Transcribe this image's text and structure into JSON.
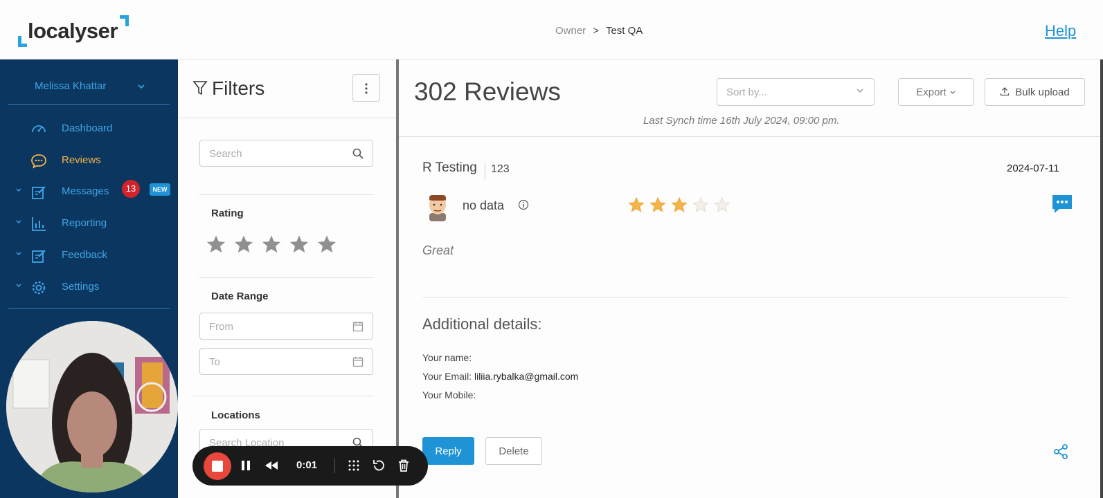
{
  "app": {
    "logo_text": "localyser",
    "breadcrumb": {
      "parent": "Owner",
      "separator": ">",
      "current": "Test QA"
    },
    "help_label": "Help"
  },
  "sidebar": {
    "user_name": "Melissa Khattar",
    "items": [
      {
        "label": "Dashboard",
        "icon": "dashboard-gauge-icon",
        "active": false
      },
      {
        "label": "Reviews",
        "icon": "chat-bubble-icon",
        "active": true
      },
      {
        "label": "Messages",
        "icon": "edit-note-icon",
        "badge_count": "13",
        "badge_new": "NEW"
      },
      {
        "label": "Reporting",
        "icon": "bar-chart-icon"
      },
      {
        "label": "Feedback",
        "icon": "feedback-edit-icon"
      },
      {
        "label": "Settings",
        "icon": "gear-icon"
      }
    ]
  },
  "filters": {
    "title": "Filters",
    "search_placeholder": "Search",
    "rating_label": "Rating",
    "date_range_label": "Date Range",
    "from_placeholder": "From",
    "to_placeholder": "To",
    "locations_label": "Locations",
    "location_placeholder": "Search Location"
  },
  "main": {
    "review_count": "302 Reviews",
    "sort_placeholder": "Sort by...",
    "export_label": "Export",
    "bulk_upload_label": "Bulk upload",
    "sync_text": "Last Synch time 16th July 2024, 09:00 pm."
  },
  "review": {
    "name": "R Testing",
    "id": "123",
    "date": "2024-07-11",
    "author": "no data",
    "rating": 3,
    "max_rating": 5,
    "comment": "Great",
    "additional_title": "Additional details:",
    "name_label": "Your name:",
    "name_value": "",
    "email_label": "Your Email:",
    "email_value": "liliia.rybalka@gmail.com",
    "mobile_label": "Your Mobile:",
    "mobile_value": "",
    "reply_label": "Reply",
    "delete_label": "Delete"
  },
  "recorder": {
    "elapsed": "0:01"
  },
  "colors": {
    "sidebar_bg": "#0a3660",
    "accent_blue": "#1e93d6",
    "active_nav": "#f6b347",
    "star_filled": "#f6b347",
    "badge_red": "#d1232a",
    "record_red": "#e8473b"
  }
}
